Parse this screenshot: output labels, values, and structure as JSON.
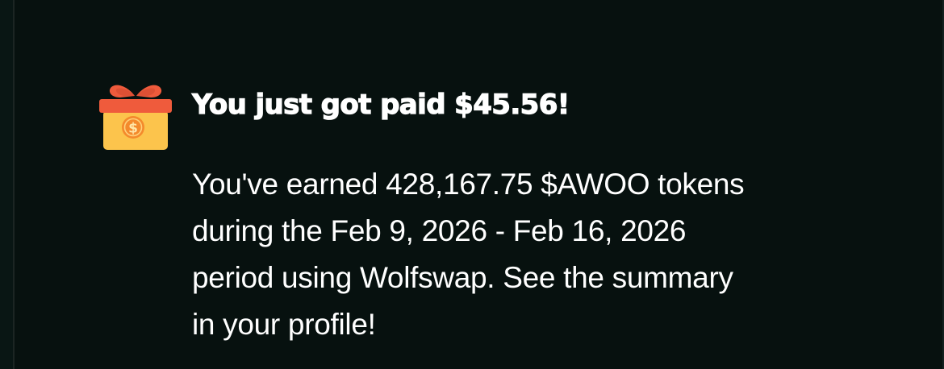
{
  "notification": {
    "icon": "gift-box-coin-icon",
    "title": "You just got paid $45.56!",
    "body_lines": [
      "You've earned 428,167.75 $AWOO tokens",
      "during the Feb 9, 2026 - Feb 16, 2026",
      "period using Wolfswap. See the summary",
      "in your profile!"
    ],
    "colors": {
      "background": "#07110f",
      "text": "#ffffff",
      "gift_box": "#fcc44c",
      "gift_ribbon": "#ef5b3c",
      "coin": "#f48a2c"
    }
  }
}
